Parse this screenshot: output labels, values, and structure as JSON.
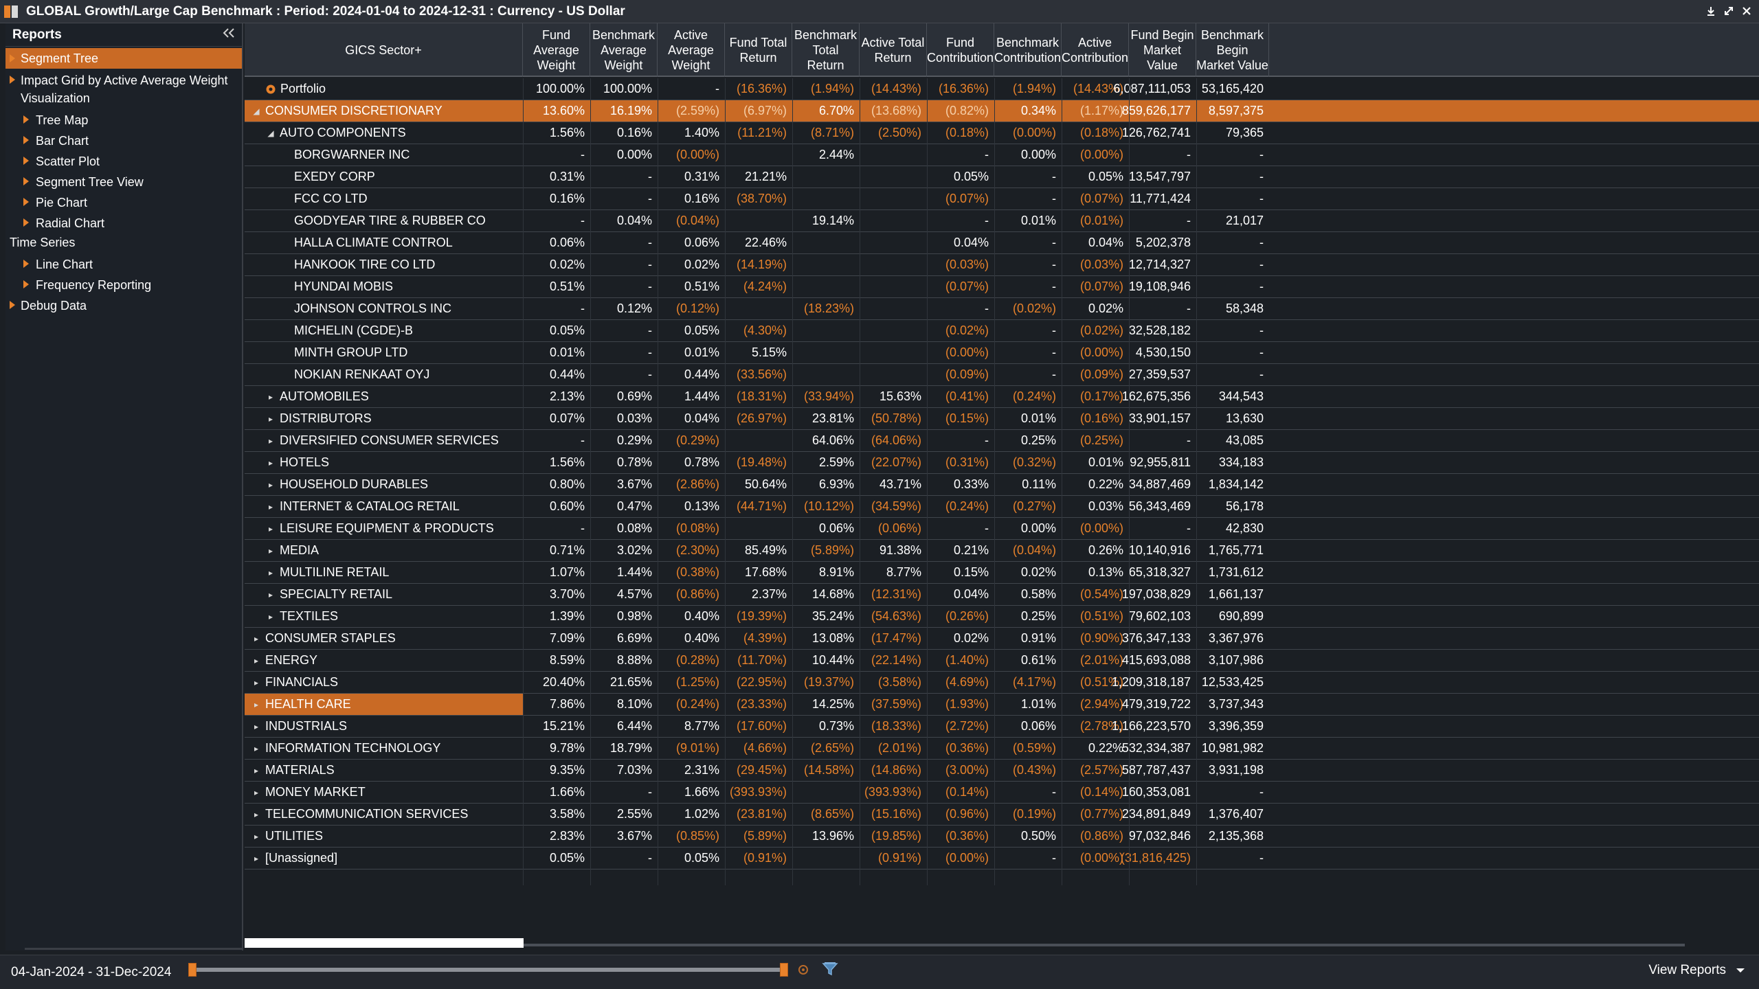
{
  "window": {
    "title": "GLOBAL Growth/Large Cap Benchmark : Period: 2024-01-04 to 2024-12-31 : Currency - US Dollar"
  },
  "sidebar": {
    "title": "Reports",
    "items": [
      {
        "label": "Segment Tree",
        "selected": true
      },
      {
        "label": "Impact Grid by Active Average Weight Visualization"
      },
      {
        "label": "Tree Map"
      },
      {
        "label": "Bar Chart"
      },
      {
        "label": "Scatter Plot"
      },
      {
        "label": "Segment Tree View"
      },
      {
        "label": "Pie Chart"
      },
      {
        "label": "Radial Chart"
      },
      {
        "label": "Time Series"
      },
      {
        "label": "Line Chart"
      },
      {
        "label": "Frequency Reporting"
      },
      {
        "label": "Debug Data"
      }
    ]
  },
  "grid": {
    "columns": [
      "GICS Sector+",
      "Fund Average Weight",
      "Benchmark Average Weight",
      "Active Average Weight",
      "Fund Total Return",
      "Benchmark Total Return",
      "Active Total Return",
      "Fund Contribution",
      "Benchmark Contribution",
      "Active Contribution",
      "Fund Begin Market Value",
      "Benchmark Begin Market Value"
    ],
    "rows": [
      {
        "name": "Portfolio",
        "level": 1,
        "exp": "root",
        "sel": false,
        "v": [
          "100.00%",
          "100.00%",
          "-",
          "(16.36%)",
          "(1.94%)",
          "(14.43%)",
          "(16.36%)",
          "(1.94%)",
          "(14.43%)",
          "6,087,111,053",
          "53,165,420"
        ]
      },
      {
        "name": "CONSUMER DISCRETIONARY",
        "level": 0,
        "exp": "open",
        "sel": true,
        "v": [
          "13.60%",
          "16.19%",
          "(2.59%)",
          "(6.97%)",
          "6.70%",
          "(13.68%)",
          "(0.82%)",
          "0.34%",
          "(1.17%)",
          "859,626,177",
          "8,597,375"
        ]
      },
      {
        "name": "AUTO COMPONENTS",
        "level": 1,
        "exp": "open",
        "sel": false,
        "v": [
          "1.56%",
          "0.16%",
          "1.40%",
          "(11.21%)",
          "(8.71%)",
          "(2.50%)",
          "(0.18%)",
          "(0.00%)",
          "(0.18%)",
          "126,762,741",
          "79,365"
        ]
      },
      {
        "name": "BORGWARNER INC",
        "level": 2,
        "exp": "none",
        "sel": false,
        "v": [
          "-",
          "0.00%",
          "(0.00%)",
          "",
          "2.44%",
          "",
          "-",
          "0.00%",
          "(0.00%)",
          "-",
          "-"
        ]
      },
      {
        "name": "EXEDY CORP",
        "level": 2,
        "exp": "none",
        "sel": false,
        "v": [
          "0.31%",
          "-",
          "0.31%",
          "21.21%",
          "",
          "",
          "0.05%",
          "-",
          "0.05%",
          "13,547,797",
          "-"
        ]
      },
      {
        "name": "FCC CO LTD",
        "level": 2,
        "exp": "none",
        "sel": false,
        "v": [
          "0.16%",
          "-",
          "0.16%",
          "(38.70%)",
          "",
          "",
          "(0.07%)",
          "-",
          "(0.07%)",
          "11,771,424",
          "-"
        ]
      },
      {
        "name": "GOODYEAR TIRE & RUBBER CO",
        "level": 2,
        "exp": "none",
        "sel": false,
        "v": [
          "-",
          "0.04%",
          "(0.04%)",
          "",
          "19.14%",
          "",
          "-",
          "0.01%",
          "(0.01%)",
          "-",
          "21,017"
        ]
      },
      {
        "name": "HALLA CLIMATE CONTROL",
        "level": 2,
        "exp": "none",
        "sel": false,
        "v": [
          "0.06%",
          "-",
          "0.06%",
          "22.46%",
          "",
          "",
          "0.04%",
          "-",
          "0.04%",
          "5,202,378",
          "-"
        ]
      },
      {
        "name": "HANKOOK TIRE CO LTD",
        "level": 2,
        "exp": "none",
        "sel": false,
        "v": [
          "0.02%",
          "-",
          "0.02%",
          "(14.19%)",
          "",
          "",
          "(0.03%)",
          "-",
          "(0.03%)",
          "12,714,327",
          "-"
        ]
      },
      {
        "name": "HYUNDAI MOBIS",
        "level": 2,
        "exp": "none",
        "sel": false,
        "v": [
          "0.51%",
          "-",
          "0.51%",
          "(4.24%)",
          "",
          "",
          "(0.07%)",
          "-",
          "(0.07%)",
          "19,108,946",
          "-"
        ]
      },
      {
        "name": "JOHNSON CONTROLS INC",
        "level": 2,
        "exp": "none",
        "sel": false,
        "v": [
          "-",
          "0.12%",
          "(0.12%)",
          "",
          "(18.23%)",
          "",
          "-",
          "(0.02%)",
          "0.02%",
          "-",
          "58,348"
        ]
      },
      {
        "name": "MICHELIN (CGDE)-B",
        "level": 2,
        "exp": "none",
        "sel": false,
        "v": [
          "0.05%",
          "-",
          "0.05%",
          "(4.30%)",
          "",
          "",
          "(0.02%)",
          "-",
          "(0.02%)",
          "32,528,182",
          "-"
        ]
      },
      {
        "name": "MINTH GROUP LTD",
        "level": 2,
        "exp": "none",
        "sel": false,
        "v": [
          "0.01%",
          "-",
          "0.01%",
          "5.15%",
          "",
          "",
          "(0.00%)",
          "-",
          "(0.00%)",
          "4,530,150",
          "-"
        ]
      },
      {
        "name": "NOKIAN RENKAAT OYJ",
        "level": 2,
        "exp": "none",
        "sel": false,
        "v": [
          "0.44%",
          "-",
          "0.44%",
          "(33.56%)",
          "",
          "",
          "(0.09%)",
          "-",
          "(0.09%)",
          "27,359,537",
          "-"
        ]
      },
      {
        "name": "AUTOMOBILES",
        "level": 1,
        "exp": "closed",
        "sel": false,
        "v": [
          "2.13%",
          "0.69%",
          "1.44%",
          "(18.31%)",
          "(33.94%)",
          "15.63%",
          "(0.41%)",
          "(0.24%)",
          "(0.17%)",
          "162,675,356",
          "344,543"
        ]
      },
      {
        "name": "DISTRIBUTORS",
        "level": 1,
        "exp": "closed",
        "sel": false,
        "v": [
          "0.07%",
          "0.03%",
          "0.04%",
          "(26.97%)",
          "23.81%",
          "(50.78%)",
          "(0.15%)",
          "0.01%",
          "(0.16%)",
          "33,901,157",
          "13,630"
        ]
      },
      {
        "name": "DIVERSIFIED CONSUMER SERVICES",
        "level": 1,
        "exp": "closed",
        "sel": false,
        "v": [
          "-",
          "0.29%",
          "(0.29%)",
          "",
          "64.06%",
          "(64.06%)",
          "-",
          "0.25%",
          "(0.25%)",
          "-",
          "43,085"
        ]
      },
      {
        "name": "HOTELS",
        "level": 1,
        "exp": "closed",
        "sel": false,
        "v": [
          "1.56%",
          "0.78%",
          "0.78%",
          "(19.48%)",
          "2.59%",
          "(22.07%)",
          "(0.31%)",
          "(0.32%)",
          "0.01%",
          "92,955,811",
          "334,183"
        ]
      },
      {
        "name": "HOUSEHOLD DURABLES",
        "level": 1,
        "exp": "closed",
        "sel": false,
        "v": [
          "0.80%",
          "3.67%",
          "(2.86%)",
          "50.64%",
          "6.93%",
          "43.71%",
          "0.33%",
          "0.11%",
          "0.22%",
          "34,887,469",
          "1,834,142"
        ]
      },
      {
        "name": "INTERNET & CATALOG RETAIL",
        "level": 1,
        "exp": "closed",
        "sel": false,
        "v": [
          "0.60%",
          "0.47%",
          "0.13%",
          "(44.71%)",
          "(10.12%)",
          "(34.59%)",
          "(0.24%)",
          "(0.27%)",
          "0.03%",
          "56,343,469",
          "56,178"
        ]
      },
      {
        "name": "LEISURE EQUIPMENT & PRODUCTS",
        "level": 1,
        "exp": "closed",
        "sel": false,
        "v": [
          "-",
          "0.08%",
          "(0.08%)",
          "",
          "0.06%",
          "(0.06%)",
          "-",
          "0.00%",
          "(0.00%)",
          "-",
          "42,830"
        ]
      },
      {
        "name": "MEDIA",
        "level": 1,
        "exp": "closed",
        "sel": false,
        "v": [
          "0.71%",
          "3.02%",
          "(2.30%)",
          "85.49%",
          "(5.89%)",
          "91.38%",
          "0.21%",
          "(0.04%)",
          "0.26%",
          "10,140,916",
          "1,765,771"
        ]
      },
      {
        "name": "MULTILINE RETAIL",
        "level": 1,
        "exp": "closed",
        "sel": false,
        "v": [
          "1.07%",
          "1.44%",
          "(0.38%)",
          "17.68%",
          "8.91%",
          "8.77%",
          "0.15%",
          "0.02%",
          "0.13%",
          "65,318,327",
          "1,731,612"
        ]
      },
      {
        "name": "SPECIALTY RETAIL",
        "level": 1,
        "exp": "closed",
        "sel": false,
        "v": [
          "3.70%",
          "4.57%",
          "(0.86%)",
          "2.37%",
          "14.68%",
          "(12.31%)",
          "0.04%",
          "0.58%",
          "(0.54%)",
          "197,038,829",
          "1,661,137"
        ]
      },
      {
        "name": "TEXTILES",
        "level": 1,
        "exp": "closed",
        "sel": false,
        "v": [
          "1.39%",
          "0.98%",
          "0.40%",
          "(19.39%)",
          "35.24%",
          "(54.63%)",
          "(0.26%)",
          "0.25%",
          "(0.51%)",
          "79,602,103",
          "690,899"
        ]
      },
      {
        "name": "CONSUMER STAPLES",
        "level": 0,
        "exp": "closed",
        "sel": false,
        "v": [
          "7.09%",
          "6.69%",
          "0.40%",
          "(4.39%)",
          "13.08%",
          "(17.47%)",
          "0.02%",
          "0.91%",
          "(0.90%)",
          "376,347,133",
          "3,367,976"
        ]
      },
      {
        "name": "ENERGY",
        "level": 0,
        "exp": "closed",
        "sel": false,
        "v": [
          "8.59%",
          "8.88%",
          "(0.28%)",
          "(11.70%)",
          "10.44%",
          "(22.14%)",
          "(1.40%)",
          "0.61%",
          "(2.01%)",
          "415,693,088",
          "3,107,986"
        ]
      },
      {
        "name": "FINANCIALS",
        "level": 0,
        "exp": "closed",
        "sel": false,
        "v": [
          "20.40%",
          "21.65%",
          "(1.25%)",
          "(22.95%)",
          "(19.37%)",
          "(3.58%)",
          "(4.69%)",
          "(4.17%)",
          "(0.51%)",
          "1,209,318,187",
          "12,533,425"
        ]
      },
      {
        "name": "HEALTH CARE",
        "level": 0,
        "exp": "closed",
        "sel": false,
        "namesel": true,
        "v": [
          "7.86%",
          "8.10%",
          "(0.24%)",
          "(23.33%)",
          "14.25%",
          "(37.59%)",
          "(1.93%)",
          "1.01%",
          "(2.94%)",
          "479,319,722",
          "3,737,343"
        ]
      },
      {
        "name": "INDUSTRIALS",
        "level": 0,
        "exp": "closed",
        "sel": false,
        "v": [
          "15.21%",
          "6.44%",
          "8.77%",
          "(17.60%)",
          "0.73%",
          "(18.33%)",
          "(2.72%)",
          "0.06%",
          "(2.78%)",
          "1,166,223,570",
          "3,396,359"
        ]
      },
      {
        "name": "INFORMATION TECHNOLOGY",
        "level": 0,
        "exp": "closed",
        "sel": false,
        "v": [
          "9.78%",
          "18.79%",
          "(9.01%)",
          "(4.66%)",
          "(2.65%)",
          "(2.01%)",
          "(0.36%)",
          "(0.59%)",
          "0.22%",
          "532,334,387",
          "10,981,982"
        ]
      },
      {
        "name": "MATERIALS",
        "level": 0,
        "exp": "closed",
        "sel": false,
        "v": [
          "9.35%",
          "7.03%",
          "2.31%",
          "(29.45%)",
          "(14.58%)",
          "(14.86%)",
          "(3.00%)",
          "(0.43%)",
          "(2.57%)",
          "587,787,437",
          "3,931,198"
        ]
      },
      {
        "name": "MONEY MARKET",
        "level": 0,
        "exp": "closed",
        "sel": false,
        "v": [
          "1.66%",
          "-",
          "1.66%",
          "(393.93%)",
          "",
          "(393.93%)",
          "(0.14%)",
          "-",
          "(0.14%)",
          "160,353,081",
          "-"
        ]
      },
      {
        "name": "TELECOMMUNICATION SERVICES",
        "level": 0,
        "exp": "closed",
        "sel": false,
        "v": [
          "3.58%",
          "2.55%",
          "1.02%",
          "(23.81%)",
          "(8.65%)",
          "(15.16%)",
          "(0.96%)",
          "(0.19%)",
          "(0.77%)",
          "234,891,849",
          "1,376,407"
        ]
      },
      {
        "name": "UTILITIES",
        "level": 0,
        "exp": "closed",
        "sel": false,
        "v": [
          "2.83%",
          "3.67%",
          "(0.85%)",
          "(5.89%)",
          "13.96%",
          "(19.85%)",
          "(0.36%)",
          "0.50%",
          "(0.86%)",
          "97,032,846",
          "2,135,368"
        ]
      },
      {
        "name": "[Unassigned]",
        "level": 0,
        "exp": "closed",
        "sel": false,
        "v": [
          "0.05%",
          "-",
          "0.05%",
          "(0.91%)",
          "",
          "(0.91%)",
          "(0.00%)",
          "-",
          "(0.00%)",
          "(31,816,425)",
          "-"
        ]
      }
    ]
  },
  "footer": {
    "date_range": "04-Jan-2024 - 31-Dec-2024",
    "view_reports": "View Reports",
    "slider_fraction": 1.0
  },
  "colors": {
    "accent": "#e8822b",
    "selection": "#c96a25",
    "background": "#1b1f24"
  }
}
